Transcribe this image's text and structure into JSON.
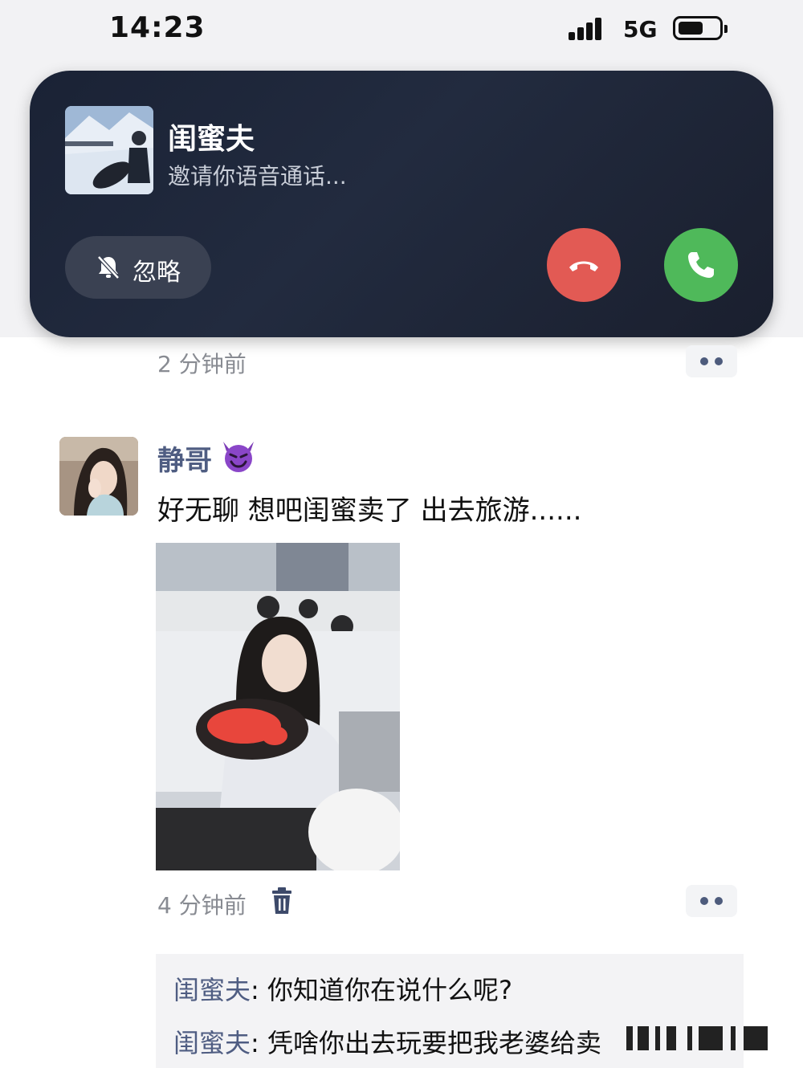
{
  "status_bar": {
    "time": "14:23",
    "network": "5G"
  },
  "call": {
    "caller_name": "闺蜜夫",
    "status_text": "邀请你语音通话...",
    "ignore_label": "忽略"
  },
  "feed": {
    "first_post_time": "2 分钟前",
    "post": {
      "author": "静哥",
      "author_emoji": "smiling-devil-emoji",
      "text": "好无聊 想吧闺蜜卖了 出去旅游......",
      "time": "4 分钟前"
    },
    "comments": [
      {
        "author": "闺蜜夫",
        "separator": ": ",
        "text": "你知道你在说什么呢?"
      },
      {
        "author": "闺蜜夫",
        "separator": ": ",
        "text": "凭啥你出去玩要把我老婆给卖"
      }
    ]
  },
  "icons": {
    "bell": "bell-muted-icon",
    "decline": "hang-up-icon",
    "accept": "phone-accept-icon",
    "trash": "trash-icon",
    "more": "more-icon"
  },
  "colors": {
    "banner_bg": "#1e2638",
    "decline": "#e25a54",
    "accept": "#4fb95a",
    "name_link": "#4f5d82",
    "meta_gray": "#888b92"
  }
}
